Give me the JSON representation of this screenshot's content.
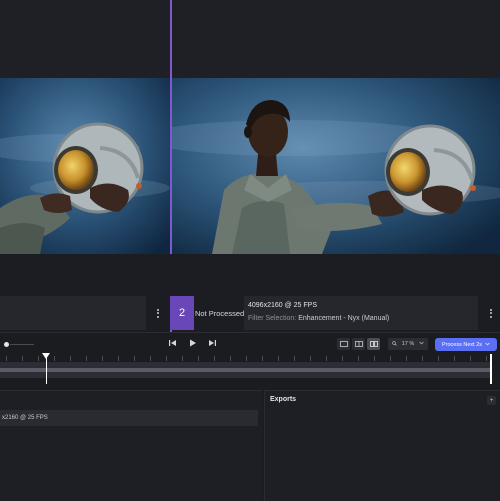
{
  "clip": {
    "number": "2",
    "status": "Not Processed",
    "resolution": "4096x2160 @ 25 FPS",
    "filter_label": "Filter Selection:",
    "filter_value": "Enhancement - Nyx (Manual)"
  },
  "timeline": {
    "zoom": "17 %",
    "process_label": "Process Next 2s"
  },
  "bottom": {
    "row_text": "x2160 @ 25 FPS"
  },
  "exports": {
    "title": "Exports",
    "button": "+"
  },
  "colors": {
    "accent": "#7e5ad1",
    "process_button": "#5b6ff2"
  }
}
